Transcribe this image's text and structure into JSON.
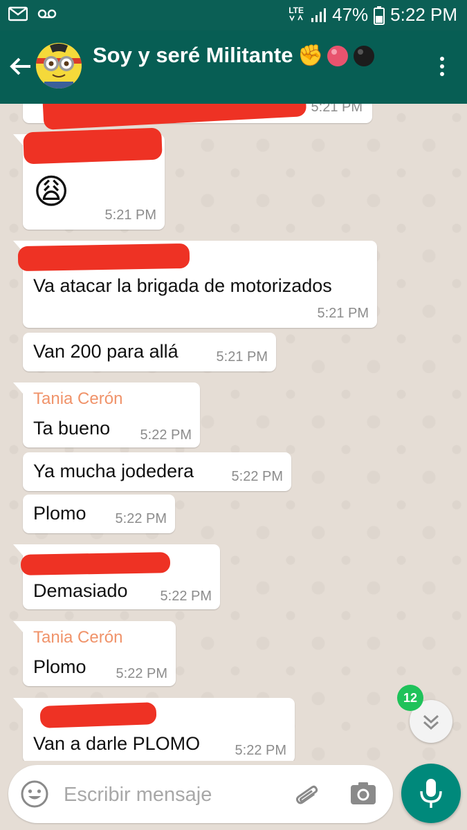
{
  "status_bar": {
    "network_type": "LTE",
    "battery": "47%",
    "time": "5:22 PM"
  },
  "header": {
    "title": "Soy y seré Militante",
    "title_emoji": "✊",
    "back_icon": "back-arrow-icon",
    "menu_icon": "more-vert-icon"
  },
  "messages": [
    {
      "sender": "",
      "text": "",
      "time": "5:21 PM",
      "redacted": true
    },
    {
      "sender": "",
      "text": "😩",
      "time": "5:21 PM"
    },
    {
      "sender": "",
      "text": "Va atacar la brigada de motorizados",
      "time": "5:21 PM"
    },
    {
      "sender": "",
      "text": "Van 200 para allá",
      "time": "5:21 PM"
    },
    {
      "sender": "Tania Cerón",
      "text": "Ta bueno",
      "time": "5:22 PM"
    },
    {
      "sender": "",
      "text": "Ya mucha jodedera",
      "time": "5:22 PM"
    },
    {
      "sender": "",
      "text": "Plomo",
      "time": "5:22 PM"
    },
    {
      "sender": "",
      "text": "Demasiado",
      "time": "5:22 PM"
    },
    {
      "sender": "Tania Cerón",
      "text": "Plomo",
      "time": "5:22 PM"
    },
    {
      "sender": "",
      "text": "Van a darle PLOMO",
      "time": "5:22 PM"
    }
  ],
  "unread_badge": "12",
  "input": {
    "placeholder": "Escribir mensaje",
    "value": ""
  },
  "colors": {
    "header": "#075e54",
    "status_bar": "#0b5f55",
    "sender_name": "#f0936a",
    "redaction": "#ee3224",
    "mic_button": "#00897b",
    "unread_badge": "#1fc25a"
  }
}
